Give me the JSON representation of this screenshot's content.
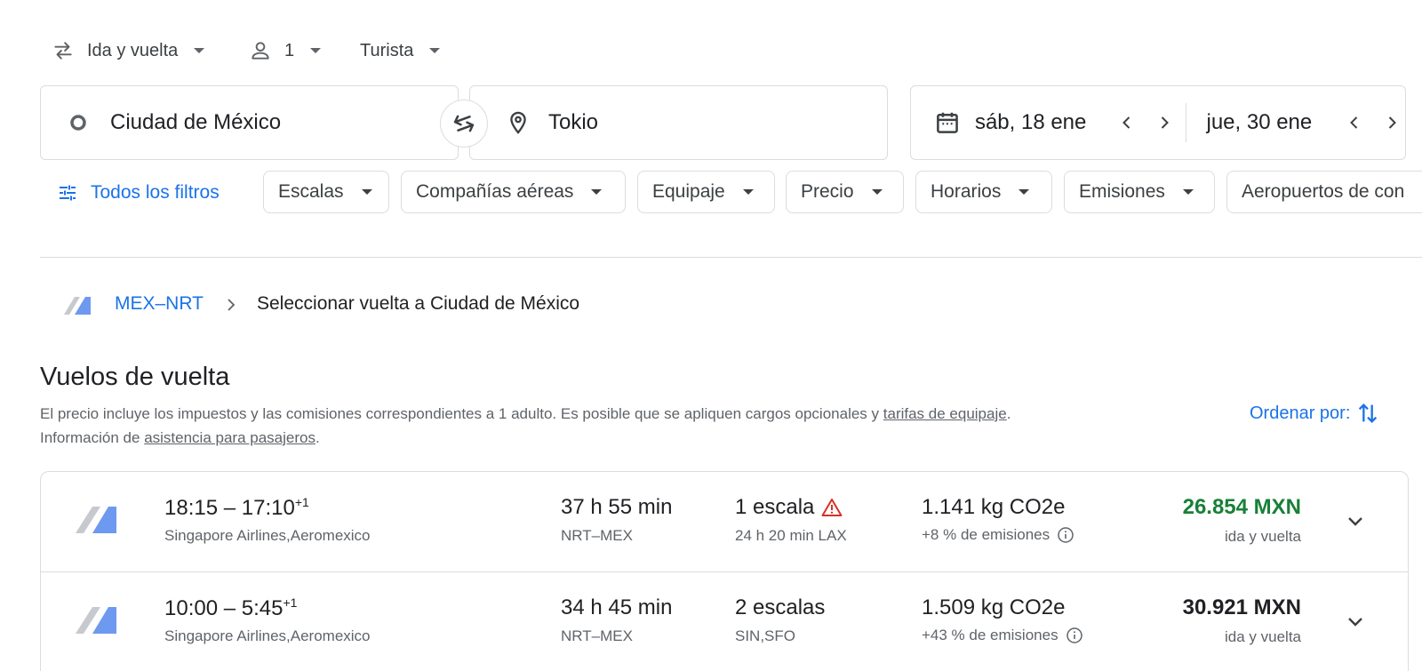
{
  "options": {
    "trip_type": "Ida y vuelta",
    "passengers": "1",
    "cabin_class": "Turista"
  },
  "search": {
    "origin": "Ciudad de México",
    "destination": "Tokio",
    "depart_date": "sáb, 18 ene",
    "return_date": "jue, 30 ene"
  },
  "filters": {
    "all_filters_label": "Todos los filtros",
    "chips": [
      "Escalas",
      "Compañías aéreas",
      "Equipaje",
      "Precio",
      "Horarios",
      "Emisiones",
      "Aeropuertos de con"
    ]
  },
  "breadcrumb": {
    "route": "MEX–NRT",
    "current": "Seleccionar vuelta a Ciudad de México"
  },
  "section": {
    "title": "Vuelos de vuelta",
    "note_part1": "El precio incluye los impuestos y las comisiones correspondientes a 1 adulto. Es posible que se apliquen cargos opcionales y ",
    "note_link1": "tarifas de equipaje",
    "note_part2": ".",
    "note_part3": "Información de ",
    "note_link2": "asistencia para pasajeros",
    "note_part4": ".",
    "sort_label": "Ordenar por:"
  },
  "flights": [
    {
      "times": "18:15 – 17:10",
      "day_offset": "+1",
      "airlines": "Singapore Airlines,Aeromexico",
      "duration": "37 h 55 min",
      "route": "NRT–MEX",
      "stops": "1 escala",
      "stop_detail": "24 h 20 min LAX",
      "emissions": "1.141 kg CO2e",
      "emissions_detail": "+8 % de emisiones",
      "price": "26.854 MXN",
      "price_note": "ida y vuelta",
      "price_color": "#188038",
      "warning": true
    },
    {
      "times": "10:00 – 5:45",
      "day_offset": "+1",
      "airlines": "Singapore Airlines,Aeromexico",
      "duration": "34 h 45 min",
      "route": "NRT–MEX",
      "stops": "2 escalas",
      "stop_detail": "SIN,SFO",
      "emissions": "1.509 kg CO2e",
      "emissions_detail": "+43 % de emisiones",
      "price": "30.921 MXN",
      "price_note": "ida y vuelta",
      "price_color": "#202124",
      "warning": false
    }
  ],
  "colors": {
    "accent": "#1a73e8",
    "good_price": "#188038",
    "warning": "#d93025"
  }
}
